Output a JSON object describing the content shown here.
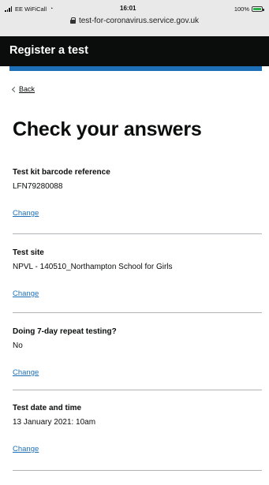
{
  "status_bar": {
    "carrier": "EE WiFiCall",
    "time": "16:01",
    "battery": "100%",
    "url": "test-for-coronavirus.service.gov.uk"
  },
  "header": {
    "service_name": "Register a test"
  },
  "back_link": "Back",
  "page_title": "Check your answers",
  "summary": [
    {
      "key": "Test kit barcode reference",
      "value": "LFN79280088",
      "action": "Change"
    },
    {
      "key": "Test site",
      "value": "NPVL - 140510_Northampton School for Girls",
      "action": "Change"
    },
    {
      "key": "Doing 7-day repeat testing?",
      "value": "No",
      "action": "Change"
    },
    {
      "key": "Test date and time",
      "value": "13 January 2021: 10am",
      "action": "Change"
    }
  ],
  "colors": {
    "header_bg": "#0b0c0c",
    "accent_blue": "#1d70b8",
    "divider": "#b1b4b6"
  }
}
